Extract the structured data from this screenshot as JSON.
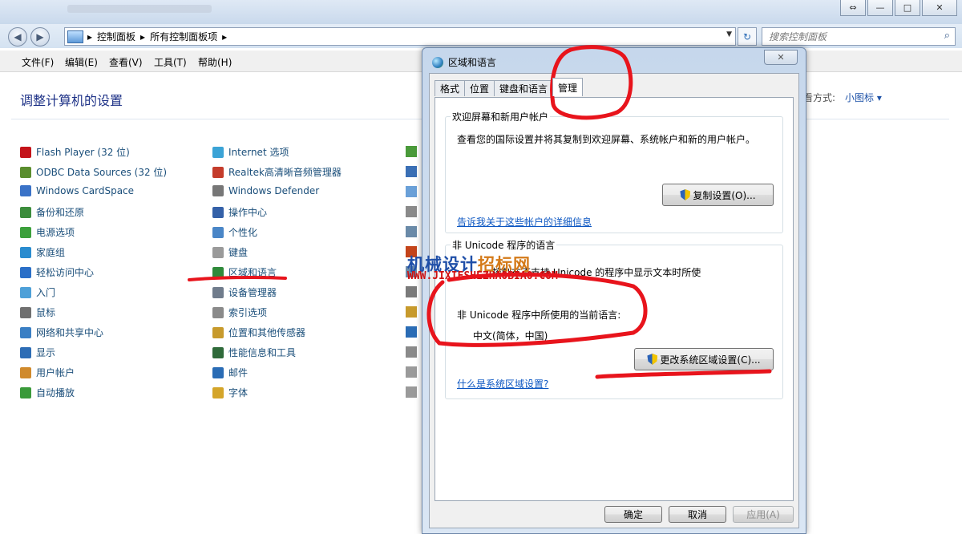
{
  "window": {
    "address_segments": [
      "控制面板",
      "所有控制面板项"
    ],
    "search_placeholder": "搜索控制面板",
    "win_buttons": [
      "⇔",
      "—",
      "□",
      "✕"
    ]
  },
  "menu": [
    "文件(F)",
    "编辑(E)",
    "查看(V)",
    "工具(T)",
    "帮助(H)"
  ],
  "content": {
    "heading": "调整计算机的设置",
    "view_by_label": "看方式:",
    "view_by_value": "小图标 ▾",
    "col1": [
      "Flash Player (32 位)",
      "ODBC Data Sources (32 位)",
      "Windows CardSpace",
      "备份和还原",
      "电源选项",
      "家庭组",
      "轻松访问中心",
      "入门",
      "鼠标",
      "网络和共享中心",
      "显示",
      "用户帐户",
      "自动播放"
    ],
    "col2": [
      "Internet 选项",
      "Realtek高清晰音频管理器",
      "Windows Defender",
      "操作中心",
      "个性化",
      "键盘",
      "区域和语言",
      "设备管理器",
      "索引选项",
      "位置和其他传感器",
      "性能信息和工具",
      "邮件",
      "字体"
    ]
  },
  "dialog": {
    "title": "区域和语言",
    "close": "✕",
    "tabs": [
      "格式",
      "位置",
      "键盘和语言",
      "管理"
    ],
    "welcome_group": {
      "label": "欢迎屏幕和新用户帐户",
      "description": "查看您的国际设置并将其复制到欢迎屏幕、系统帐户和新的用户帐户。",
      "button": "复制设置(O)...",
      "link": "告诉我关于这些帐户的详细信息"
    },
    "unicode_group": {
      "label": "非 Unicode 程序的语言",
      "description_tail": "控制在不支持 Unicode 的程序中显示文本时所使",
      "current_label": "非 Unicode 程序中所使用的当前语言:",
      "current_value": "中文(简体，中国)",
      "button": "更改系统区域设置(C)...",
      "link": "什么是系统区域设置?"
    },
    "footer": {
      "ok": "确定",
      "cancel": "取消",
      "apply": "应用(A)"
    }
  },
  "watermark": {
    "line1_a": "机械设计",
    "line1_b": "招标网",
    "line2": "WWW.JIXIESHEZHAOBIAO.COM"
  },
  "colors": {
    "annotation": "#e8141c",
    "link": "#0b56c2",
    "heading": "#1e3287"
  }
}
